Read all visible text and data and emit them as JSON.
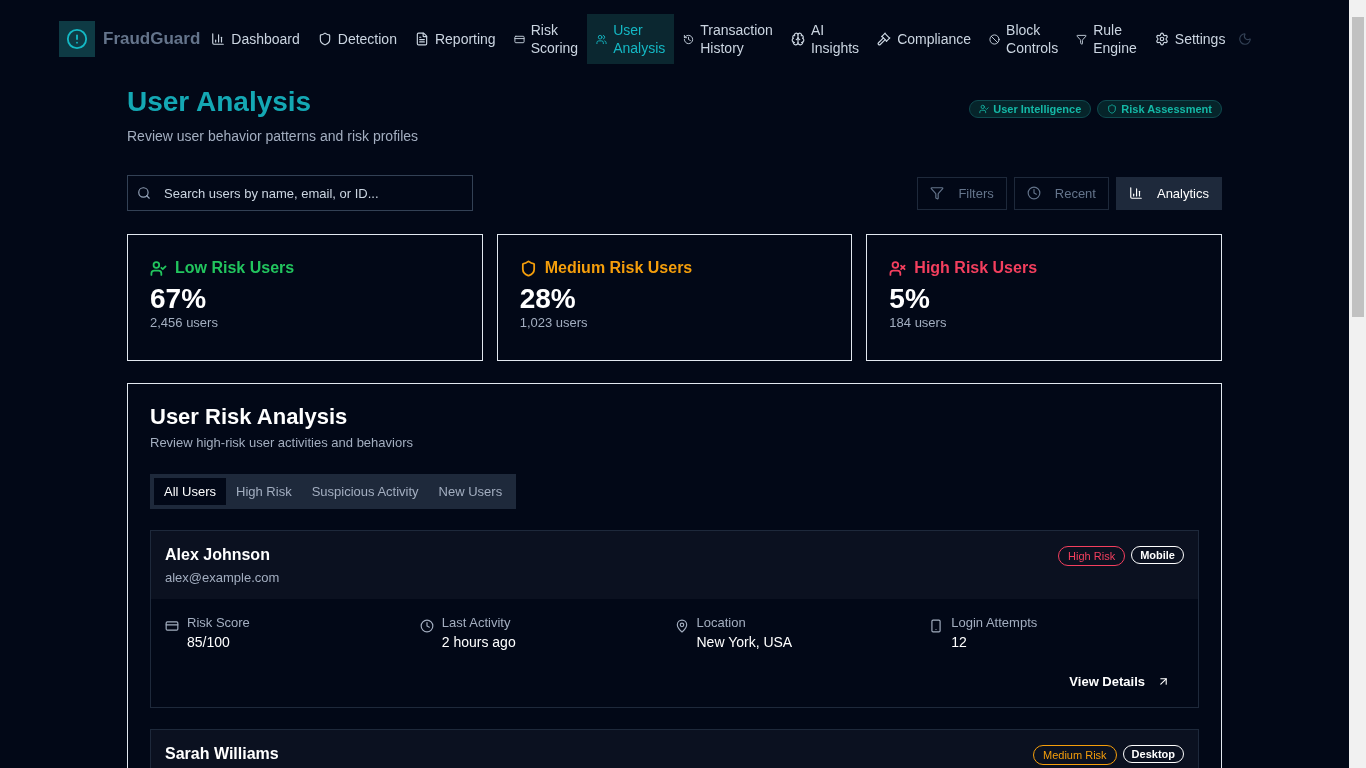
{
  "brand": "FraudGuard",
  "nav": [
    {
      "label": "Dashboard",
      "selected": false
    },
    {
      "label": "Detection",
      "selected": false
    },
    {
      "label": "Reporting",
      "selected": false
    },
    {
      "label": "Risk Scoring",
      "selected": false
    },
    {
      "label": "User Analysis",
      "selected": true
    },
    {
      "label": "Transaction History",
      "selected": false
    },
    {
      "label": "AI Insights",
      "selected": false
    },
    {
      "label": "Compliance",
      "selected": false
    },
    {
      "label": "Block Controls",
      "selected": false
    },
    {
      "label": "Rule Engine",
      "selected": false
    },
    {
      "label": "Settings",
      "selected": false
    }
  ],
  "page": {
    "title": "User Analysis",
    "subtitle": "Review user behavior patterns and risk profiles",
    "badges": [
      "User Intelligence",
      "Risk Assessment"
    ]
  },
  "search": {
    "placeholder": "Search users by name, email, or ID..."
  },
  "actions": [
    {
      "label": "Filters",
      "selected": false
    },
    {
      "label": "Recent",
      "selected": false
    },
    {
      "label": "Analytics",
      "selected": true
    }
  ],
  "stats": [
    {
      "title": "Low Risk Users",
      "value": "67%",
      "count": "2,456 users",
      "color": "#22c55e"
    },
    {
      "title": "Medium Risk Users",
      "value": "28%",
      "count": "1,023 users",
      "color": "#f59e0b"
    },
    {
      "title": "High Risk Users",
      "value": "5%",
      "count": "184 users",
      "color": "#f43f5e"
    }
  ],
  "analysis": {
    "title": "User Risk Analysis",
    "subtitle": "Review high-risk user activities and behaviors",
    "tabs": [
      {
        "label": "All Users",
        "selected": true
      },
      {
        "label": "High Risk",
        "selected": false
      },
      {
        "label": "Suspicious Activity",
        "selected": false
      },
      {
        "label": "New Users",
        "selected": false
      }
    ],
    "users": [
      {
        "name": "Alex Johnson",
        "email": "alex@example.com",
        "risk": "High Risk",
        "color": "#f43f5e",
        "device": "Mobile",
        "details": [
          {
            "label": "Risk Score",
            "value": "85/100"
          },
          {
            "label": "Last Activity",
            "value": "2 hours ago"
          },
          {
            "label": "Location",
            "value": "New York, USA"
          },
          {
            "label": "Login Attempts",
            "value": "12"
          }
        ],
        "link": "View Details"
      },
      {
        "name": "Sarah Williams",
        "risk": "Medium Risk",
        "color": "#f59e0b",
        "device": "Desktop"
      }
    ]
  }
}
